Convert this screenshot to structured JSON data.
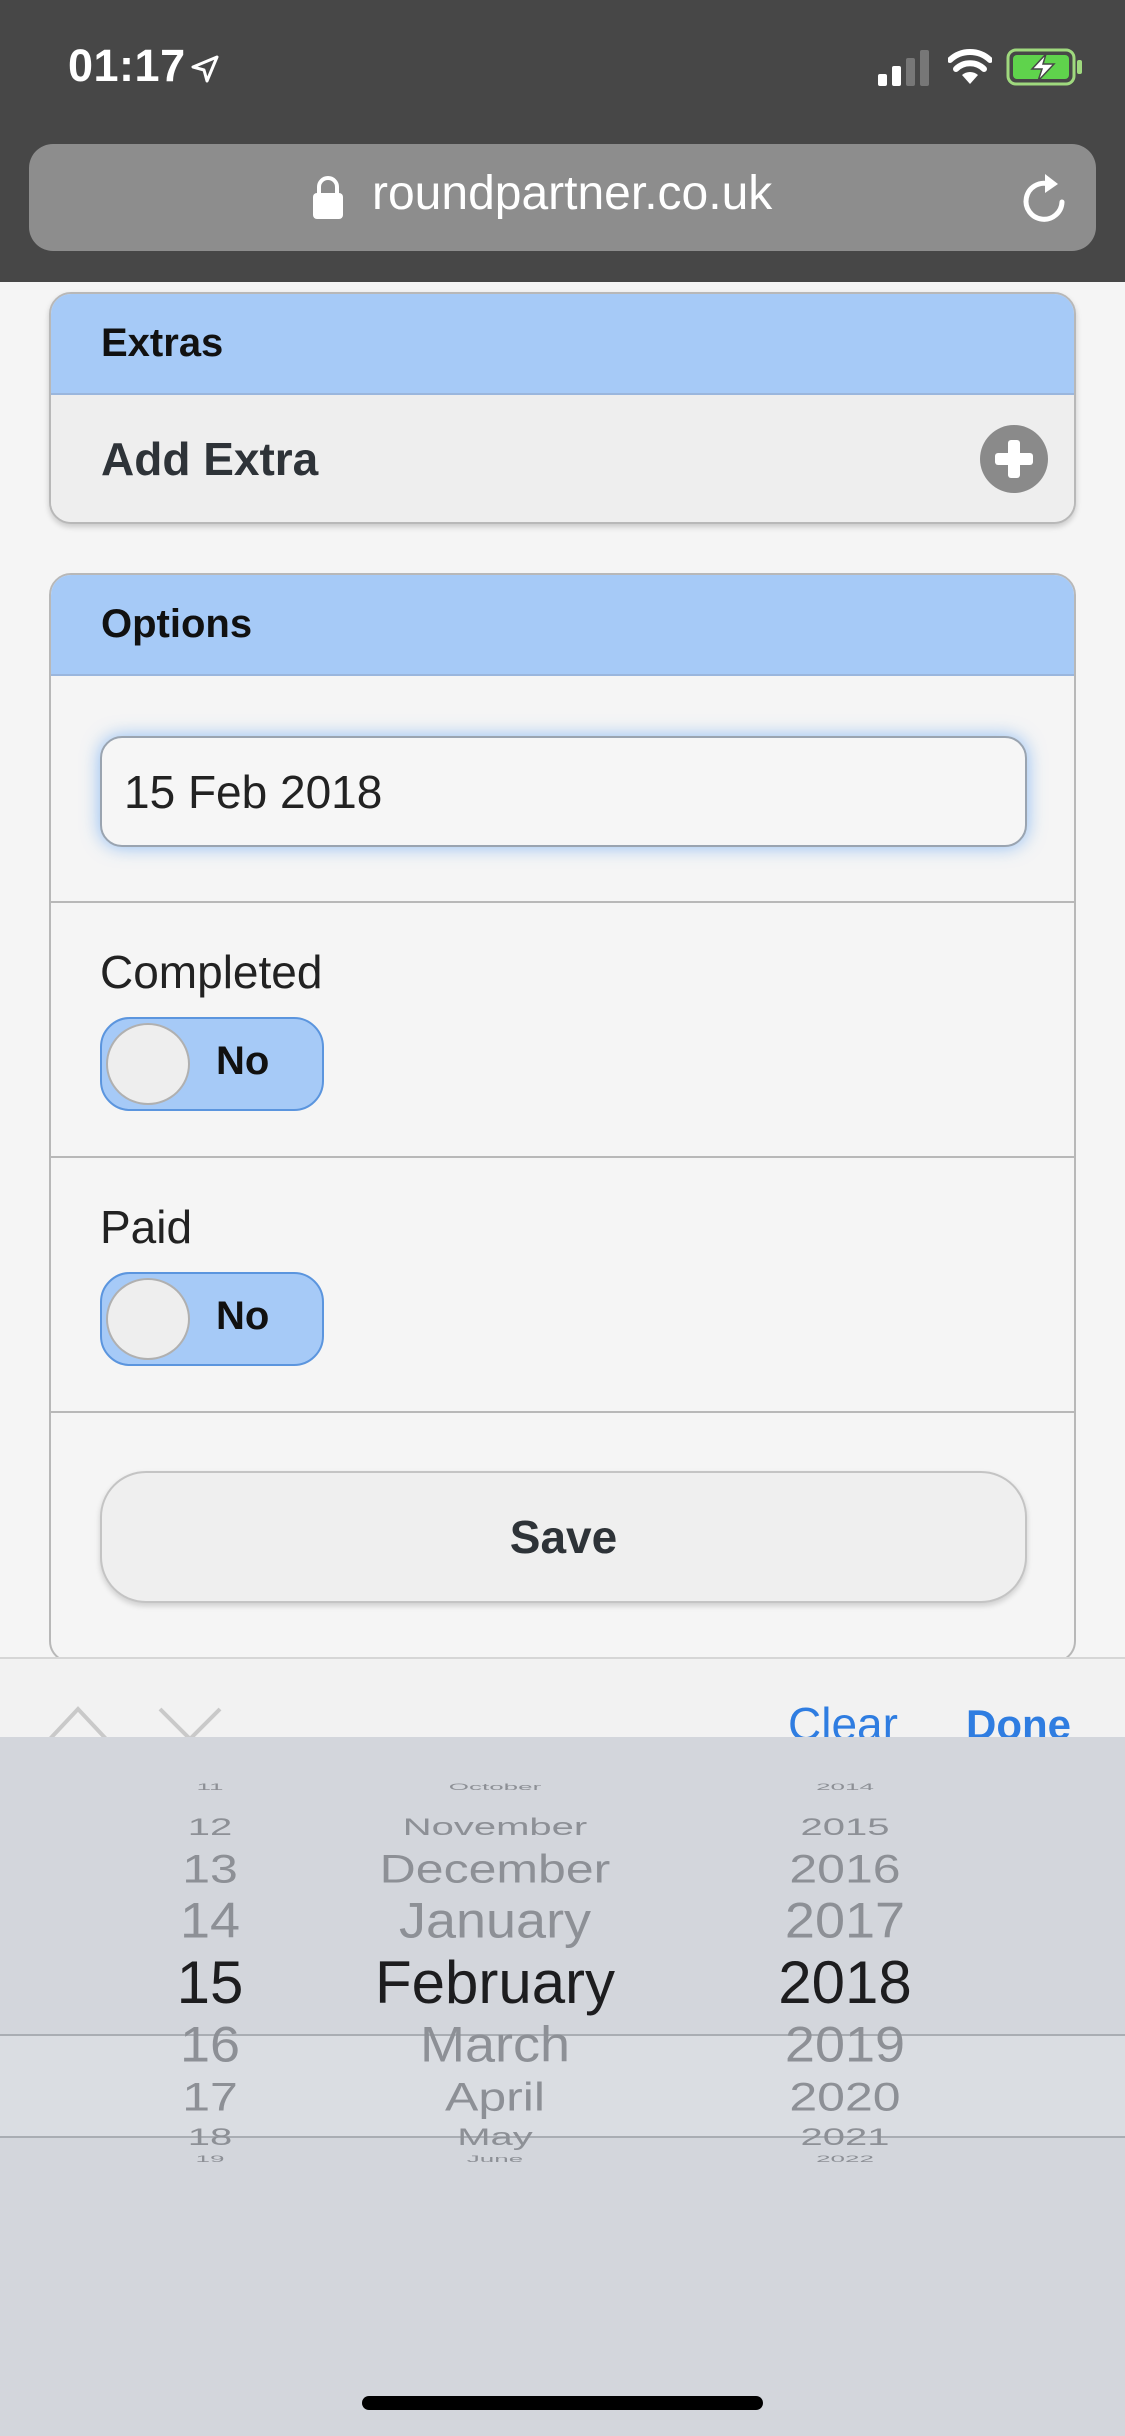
{
  "status_bar": {
    "time": "01:17"
  },
  "browser": {
    "url": "roundpartner.co.uk"
  },
  "extras": {
    "title": "Extras",
    "add_label": "Add Extra"
  },
  "options": {
    "title": "Options",
    "date_value": "15 Feb 2018",
    "completed_label": "Completed",
    "completed_value": "No",
    "paid_label": "Paid",
    "paid_value": "No",
    "save_label": "Save"
  },
  "accessory": {
    "clear_label": "Clear",
    "done_label": "Done"
  },
  "picker": {
    "days": [
      "11",
      "12",
      "13",
      "14",
      "15",
      "16",
      "17",
      "18",
      "19"
    ],
    "months": [
      "October",
      "November",
      "December",
      "January",
      "February",
      "March",
      "April",
      "May",
      "June"
    ],
    "years": [
      "2014",
      "2015",
      "2016",
      "2017",
      "2018",
      "2019",
      "2020",
      "2021",
      "2022"
    ],
    "selected": {
      "day": "15",
      "month": "February",
      "year": "2018"
    }
  },
  "colors": {
    "header_blue": "#a6caf7",
    "link_blue": "#2f7de1",
    "chrome": "#474747"
  }
}
